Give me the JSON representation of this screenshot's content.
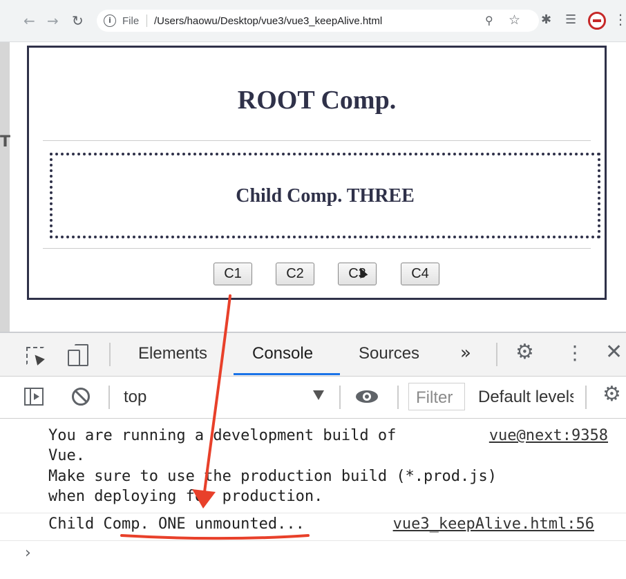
{
  "browser": {
    "back_glyph": "←",
    "forward_glyph": "→",
    "reload_glyph": "↻",
    "info_glyph": "i",
    "scheme_label": "File",
    "url": "/Users/haowu/Desktop/vue3/vue3_keepAlive.html",
    "icons": [
      "back-icon",
      "forward-icon",
      "reload-icon",
      "info-icon",
      "zoom-icon",
      "bookmark-star-icon",
      "extensions-puzzle-icon",
      "reading-list-icon",
      "profile-avatar",
      "menu-icon"
    ]
  },
  "page": {
    "root_title": "ROOT Comp.",
    "child_title": "Child Comp. THREE",
    "buttons": [
      "C1",
      "C2",
      "C3",
      "C4"
    ],
    "accent_color": "#2f3149"
  },
  "devtools": {
    "tabs": [
      "Elements",
      "Console",
      "Sources"
    ],
    "active_tab": "Console",
    "more_tabs_glyph": "»",
    "context": "top",
    "filter_placeholder": "Filter",
    "levels": "Default levels",
    "messages": [
      {
        "lines": [
          "You are running a development build of",
          "Vue.",
          "Make sure to use the production build (*.prod.js)",
          "when deploying for production."
        ],
        "source": "vue@next:9358"
      },
      {
        "lines": [
          "Child Comp. ONE unmounted..."
        ],
        "source": "vue3_keepAlive.html:56"
      }
    ],
    "prompt_glyph": "›",
    "tab_underline_color": "#1a73e8"
  },
  "annotation": {
    "arrow_color": "#e8402a"
  }
}
